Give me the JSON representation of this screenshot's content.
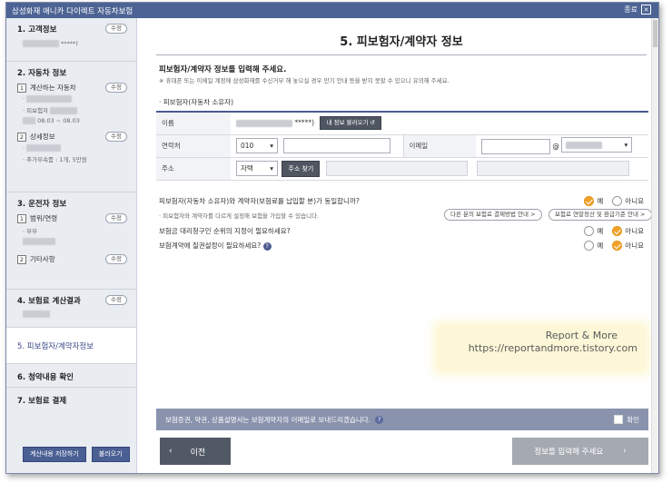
{
  "window": {
    "title": "삼성화재 애니카 다이렉트 자동차보험",
    "close_label": "종료",
    "close_icon": "close-icon"
  },
  "sidebar": {
    "sections": [
      {
        "title": "1. 고객정보",
        "badge": "수정",
        "masked": "*****)"
      },
      {
        "title": "2. 자동차 정보",
        "subs": [
          {
            "num": "1",
            "label": "계산하는 자동차",
            "badge": "수정",
            "lines": [
              "·",
              "· 피보험자",
              "08.03 ~ 08.03"
            ]
          },
          {
            "num": "2",
            "label": "상세정보",
            "badge": "수정",
            "lines": [
              "·",
              "· 추가부속품 : 1개, 5만원"
            ]
          }
        ]
      },
      {
        "title": "3. 운전자 정보",
        "subs": [
          {
            "num": "1",
            "label": "범위/연령",
            "badge": "수정",
            "lines": [
              "· 부부"
            ]
          },
          {
            "num": "2",
            "label": "기타사항",
            "badge": "수정",
            "lines": []
          }
        ]
      },
      {
        "title": "4. 보험료 계산결과",
        "badge": "수정"
      },
      {
        "title": "5. 피보험자/계약자정보"
      },
      {
        "title": "6. 청약내용 확인"
      },
      {
        "title": "7. 보험료 결제"
      }
    ],
    "buttons": {
      "save": "계산내용 저장하기",
      "load": "불러오기"
    }
  },
  "main": {
    "title": "5. 피보험자/계약자 정보",
    "lead": "피보험자/계약자 정보를 입력해 주세요.",
    "note": "※ 휴대폰 또는 이메일 계정에 삼성화재를 수신거부 해 놓으실 경우 만기 안내 등을 받지 못할 수 있으니 유의해 주세요.",
    "subhead": "· 피보험자(자동차 소유자)",
    "form": {
      "name_label": "이름",
      "name_masked": "*****)",
      "load_btn": "내 정보 불러오기",
      "phone_label": "연락처",
      "phone_prefix": "010",
      "email_label": "이메일",
      "email_at": "@",
      "address_label": "주소",
      "address_type": "자택",
      "address_btn": "주소 찾기"
    },
    "questions": [
      {
        "text": "피보험자(자동차 소유자)와 계약자(보험료를 납입할 분)가 동일합니까?",
        "yes": "예",
        "no": "아니요",
        "selected": "yes"
      },
      {
        "text": "보험금 대리청구인 순위의 지정이 필요하세요?",
        "yes": "예",
        "no": "아니요",
        "selected": "no"
      },
      {
        "text": "보험계약에 질권설정이 필요하세요?",
        "yes": "예",
        "no": "아니요",
        "selected": "no"
      }
    ],
    "question_sub": "· 피보험자와 계약자를 다르게 설정해 보험을 가입할 수 있습니다.",
    "guide_btn_1": "다른 분의 보험료 결제방법 안내 >",
    "guide_btn_2": "보험료 연말정산 및 환급기준 안내 >",
    "watermark_line1": "Report & More",
    "watermark_line2": "https://reportandmore.tistory.com",
    "bottom_bar_text": "보험증권, 약관, 상품설명서는 보험계약자의 이메일로 보내드리겠습니다.",
    "confirm_label": "확인",
    "prev_label": "이전",
    "next_label": "정보를 입력해 주세요"
  }
}
